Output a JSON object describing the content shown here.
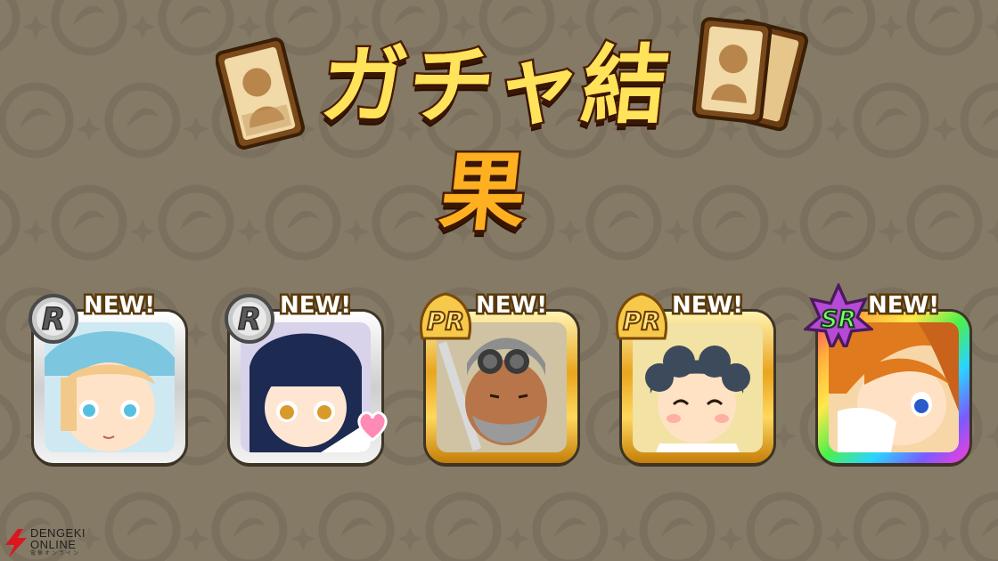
{
  "screen": {
    "title": "ガチャ結果",
    "background_color": "#847a66",
    "title_color": "#ffb020"
  },
  "results": [
    {
      "rarity": "R",
      "badge": "NEW!",
      "frame": "silver",
      "character": "girl-blonde-blue-eyes-blue-hat",
      "hair": "#f2c98a",
      "bg": "#cfe9f3"
    },
    {
      "rarity": "R",
      "badge": "NEW!",
      "frame": "silver",
      "character": "girl-dark-hair-amber-eyes-heart",
      "hair": "#1d2a52",
      "bg": "#d8d2ea"
    },
    {
      "rarity": "PR",
      "badge": "NEW!",
      "frame": "gold",
      "character": "bearded-man-goggles-sword",
      "hair": "#8e8e8e",
      "bg": "#cfc3a4"
    },
    {
      "rarity": "PR",
      "badge": "NEW!",
      "frame": "gold",
      "character": "smiling-boy-dark-curly-hair",
      "hair": "#3c4a5c",
      "bg": "#f2e2a3"
    },
    {
      "rarity": "SR",
      "badge": "NEW!",
      "frame": "rainbow",
      "character": "orange-hair-boy-blue-eyes-mask",
      "hair": "#e07a1e",
      "bg": "#f7d7a8"
    }
  ],
  "watermark": {
    "line1": "DENGEKI",
    "line2": "ONLINE",
    "line3": "電撃オンライン"
  }
}
